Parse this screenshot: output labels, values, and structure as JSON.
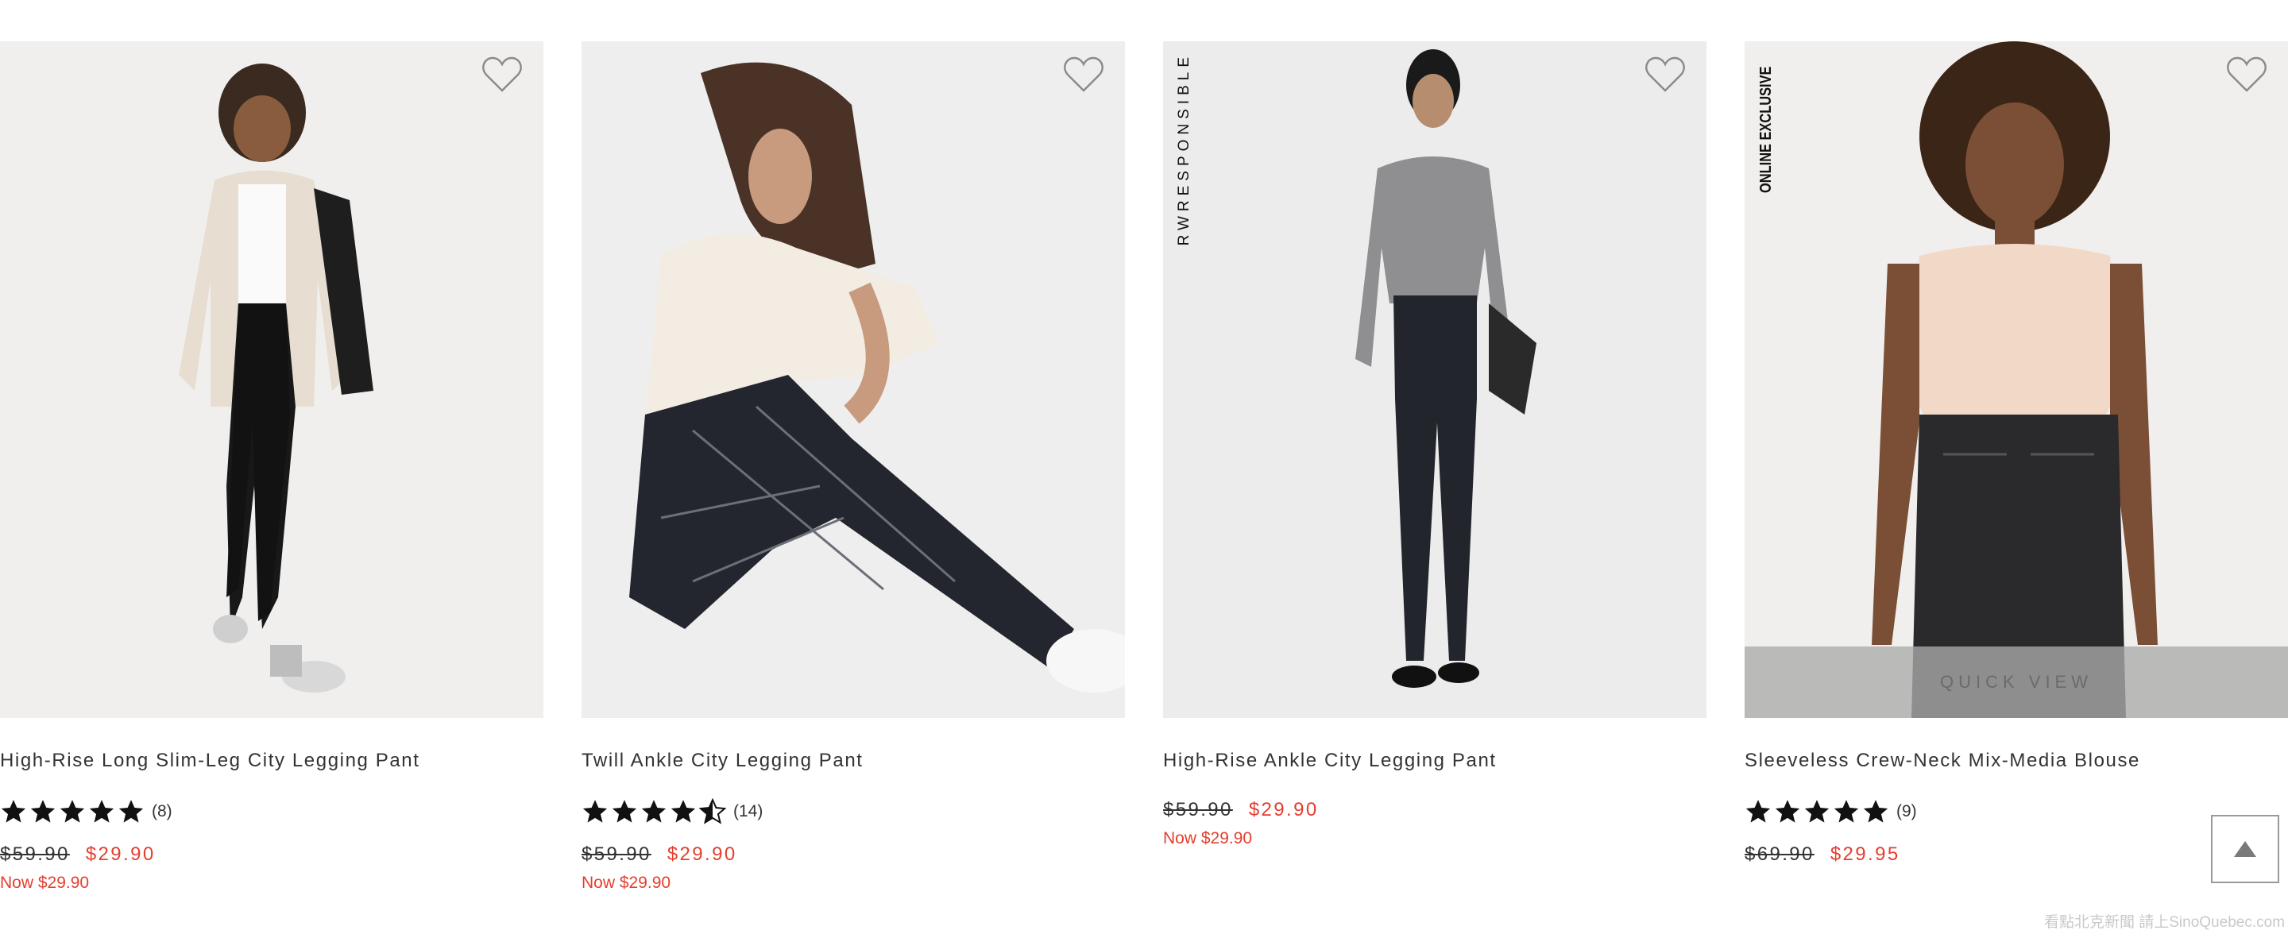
{
  "products": [
    {
      "name": "High-Rise Long Slim-Leg City Legging Pant",
      "rating": 5,
      "review_count": "(8)",
      "was_price": "$59.90",
      "sale_price": "$29.90",
      "now_text": "Now $29.90",
      "image": "model-cardigan-leggings",
      "icon": "heart-outline-icon"
    },
    {
      "name": "Twill Ankle City Legging Pant",
      "rating": 4.5,
      "review_count": "(14)",
      "was_price": "$59.90",
      "sale_price": "$29.90",
      "now_text": "Now $29.90",
      "image": "model-seated-plaid-pant",
      "icon": "heart-outline-icon"
    },
    {
      "name": "High-Rise Ankle City Legging Pant",
      "badge": "RWRESPONSIBLE",
      "was_price": "$59.90",
      "sale_price": "$29.90",
      "now_text": "Now $29.90",
      "image": "model-grey-cardigan",
      "icon": "heart-outline-icon"
    },
    {
      "name": "Sleeveless Crew-Neck Mix-Media Blouse",
      "badge": "ONLINE EXCLUSIVE",
      "rating": 5,
      "review_count": "(9)",
      "was_price": "$69.90",
      "sale_price": "$29.95",
      "quick_view": "QUICK VIEW",
      "image": "model-blouse-jeans",
      "icon": "heart-outline-icon"
    }
  ],
  "footer_watermark": "看點北克新聞 請上SinoQuebec.com",
  "colors": {
    "sale": "#e53e2e",
    "text": "#333333",
    "image_bg": "#efeeee"
  },
  "scroll_top_icon": "triangle-up-icon"
}
